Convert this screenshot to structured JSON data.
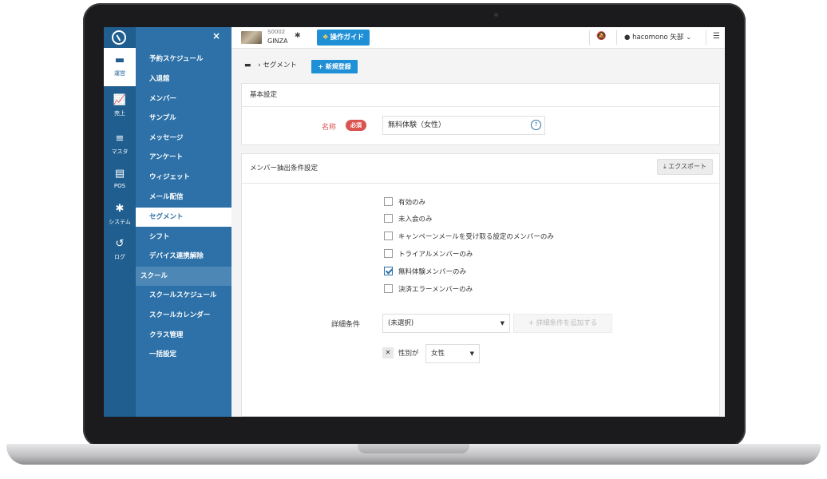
{
  "rail": {
    "items": [
      {
        "icon": "▬",
        "label": "運営"
      },
      {
        "icon": "📈",
        "label": "売上"
      },
      {
        "icon": "≡",
        "label": "マスタ"
      },
      {
        "icon": "▤",
        "label": "POS"
      },
      {
        "icon": "✱",
        "label": "システム"
      },
      {
        "icon": "↺",
        "label": "ログ"
      }
    ]
  },
  "menu": {
    "close": "×",
    "items": [
      "予約スケジュール",
      "入退館",
      "メンバー",
      "サンプル",
      "メッセージ",
      "アンケート",
      "ウィジェット",
      "メール配信",
      "セグメント",
      "シフト",
      "デバイス連携解除"
    ],
    "section": "スクール",
    "section_items": [
      "スクールスケジュール",
      "スクールカレンダー",
      "クラス管理",
      "一括設定"
    ]
  },
  "topbar": {
    "store_code": "S0002",
    "store_name": "GINZA",
    "guide_label": "操作ガイド",
    "user_name": "hacomono 矢部"
  },
  "breadcrumb": {
    "current": "セグメント",
    "new_button": "新規登録"
  },
  "basic": {
    "heading": "基本設定",
    "name_label": "名称",
    "required_badge": "必須",
    "name_value": "無料体験（女性）"
  },
  "extract": {
    "heading": "メンバー抽出条件設定",
    "export_label": "エクスポート",
    "checkboxes": [
      {
        "label": "有効のみ",
        "checked": false
      },
      {
        "label": "未入会のみ",
        "checked": false
      },
      {
        "label": "キャンペーンメールを受け取る設定のメンバーのみ",
        "checked": false
      },
      {
        "label": "トライアルメンバーのみ",
        "checked": false
      },
      {
        "label": "無料体験メンバーのみ",
        "checked": true
      },
      {
        "label": "決済エラーメンバーのみ",
        "checked": false
      }
    ],
    "detail_label": "詳細条件",
    "detail_select": "(未選択)",
    "add_condition": "+ 詳細条件を追加する",
    "condition_label": "性別が",
    "condition_value": "女性"
  },
  "colors": {
    "sidebar": "#2d71a8",
    "rail": "#1f5e8f",
    "primary_button": "#1f8fd6",
    "required": "#d9534f"
  }
}
